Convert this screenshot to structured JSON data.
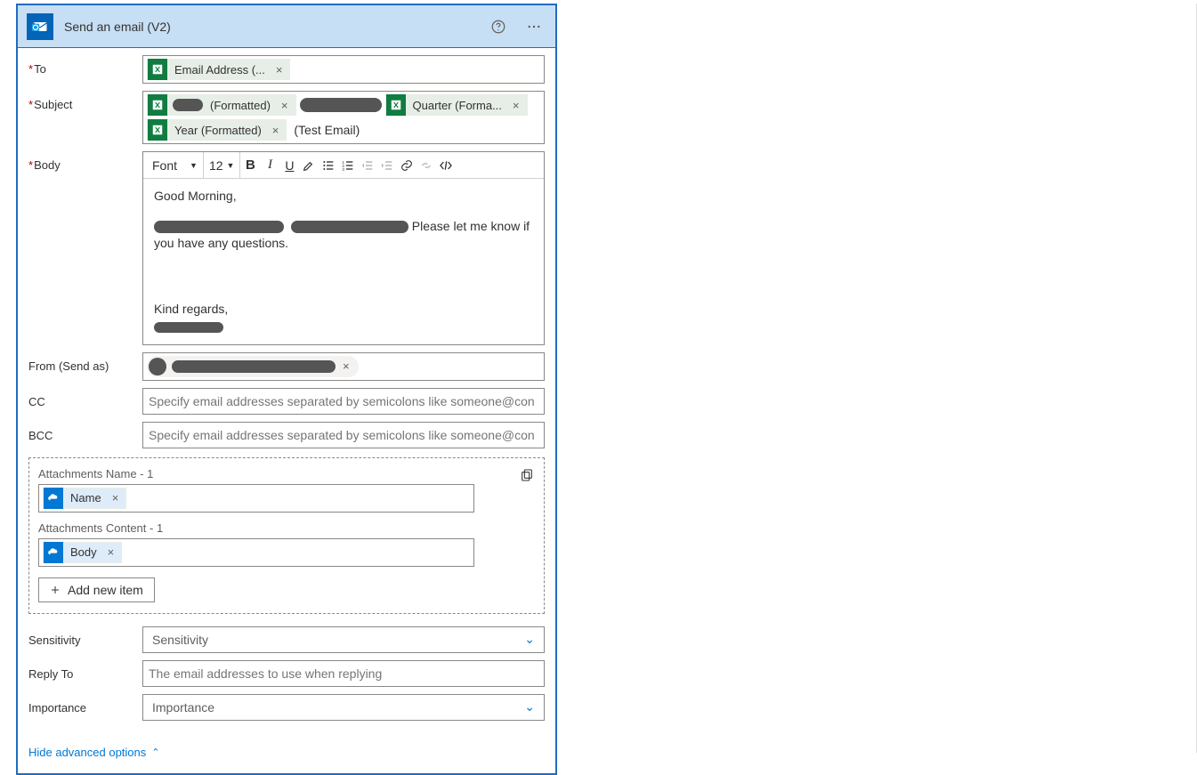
{
  "header": {
    "title": "Send an email (V2)"
  },
  "labels": {
    "to": "To",
    "subject": "Subject",
    "body": "Body",
    "from": "From (Send as)",
    "cc": "CC",
    "bcc": "BCC",
    "sensitivity": "Sensitivity",
    "reply_to": "Reply To",
    "importance": "Importance"
  },
  "to": {
    "chips": [
      {
        "label": "Email Address (..."
      }
    ]
  },
  "subject": {
    "chips": [
      {
        "label": "(Formatted)",
        "redacted_prefix": true
      },
      {
        "redacted_only": true
      },
      {
        "label": "Quarter (Forma..."
      },
      {
        "label": "Year (Formatted)"
      }
    ],
    "suffix_text": "(Test Email)"
  },
  "toolbar": {
    "font_name": "Font",
    "font_size": "12"
  },
  "body_text": {
    "line1": "Good Morning,",
    "line2_tail": "Please let me know if you have any questions.",
    "line3": "Kind regards,"
  },
  "cc": {
    "placeholder": "Specify email addresses separated by semicolons like someone@con"
  },
  "bcc": {
    "placeholder": "Specify email addresses separated by semicolons like someone@con"
  },
  "attachments": {
    "name_label": "Attachments Name - 1",
    "content_label": "Attachments Content - 1",
    "name_chip": "Name",
    "content_chip": "Body",
    "add_new": "Add new item"
  },
  "sensitivity": {
    "placeholder": "Sensitivity"
  },
  "reply_to": {
    "placeholder": "The email addresses to use when replying"
  },
  "importance": {
    "placeholder": "Importance"
  },
  "footer": {
    "hide_advanced": "Hide advanced options"
  }
}
